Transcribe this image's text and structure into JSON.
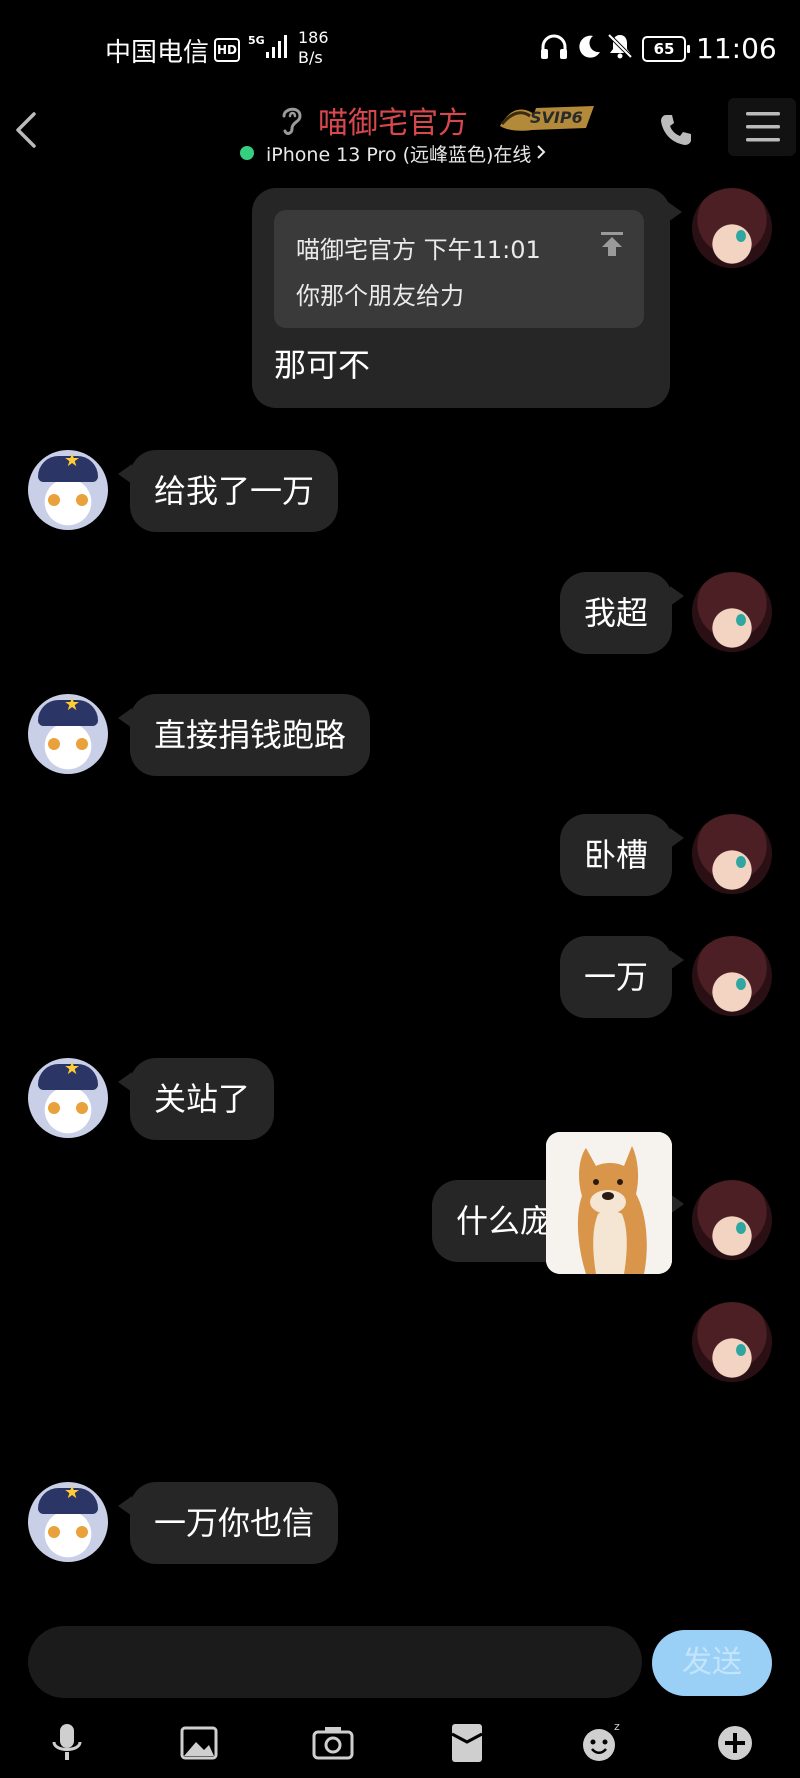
{
  "status_bar": {
    "carrier": "中国电信",
    "hd": "HD",
    "network": "5G",
    "speed_value": "186",
    "speed_unit": "B/s",
    "battery": "65",
    "time": "11:06"
  },
  "header": {
    "contact_name": "喵御宅官方",
    "badge": "SVIP6",
    "device_status": "iPhone 13 Pro (远峰蓝色)在线",
    "name_color": "#d7484e",
    "online_color": "#35d07f"
  },
  "chat": {
    "quoted": {
      "sender": "喵御宅官方",
      "time": "下午11:01",
      "text": "你那个朋友给力"
    },
    "reply_text": "那可不",
    "messages": [
      {
        "side": "left",
        "text": "给我了一万"
      },
      {
        "side": "right",
        "text": "我超"
      },
      {
        "side": "left",
        "text": "直接捐钱跑路"
      },
      {
        "side": "right",
        "text": "卧槽"
      },
      {
        "side": "right",
        "text": "一万"
      },
      {
        "side": "left",
        "text": "关站了"
      },
      {
        "side": "right",
        "text": "什么庞氏骗局"
      },
      {
        "side": "left",
        "text": "一万你也信"
      }
    ]
  },
  "input": {
    "placeholder": "",
    "send_label": "发送",
    "send_color": "#9ad0f6"
  },
  "toolbar": {
    "icons": [
      "microphone-icon",
      "image-icon",
      "camera-icon",
      "red-packet-icon",
      "emoji-icon",
      "plus-icon"
    ]
  }
}
